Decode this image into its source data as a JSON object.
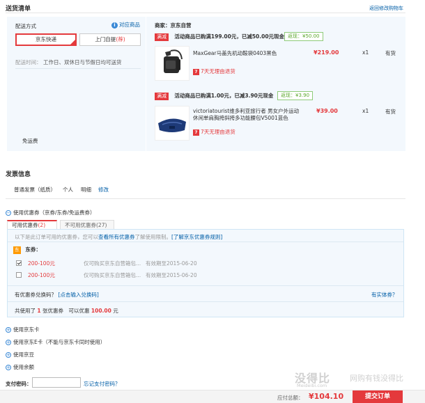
{
  "header": {
    "title": "送货清单",
    "back_link": "返回修改购物车"
  },
  "shipping": {
    "label": "配送方式",
    "help_link": "对应商品",
    "option_jd": "京东快递",
    "option_pickup": "上门自提",
    "pickup_badge": "荐",
    "time_label": "配送时间：",
    "time_value": "工作日、双休日与节假日均可送货",
    "free_shipping": "免运费"
  },
  "seller": {
    "label": "商家：京东自营"
  },
  "groups": [
    {
      "tag": "满减",
      "promo_text": "活动商品已购满199.00元，已减50.00元现金",
      "chip": "返现：¥50.00",
      "product": {
        "name": "MaxGear马盖先机动鞍袋0403黑色",
        "price": "¥219.00",
        "qty": "x1",
        "stock": "有货",
        "return_note": "7天无理由退货"
      }
    },
    {
      "tag": "满减",
      "promo_text": "活动商品已购满1.00元，已减3.90元现金",
      "chip": "返现：¥3.90",
      "product": {
        "name_line1": "victoriatourist维多利亚旅行者 男女户外运动",
        "name_line2": "休闲单肩胸挎斜挎多功能腰包V5001蓝色",
        "price": "¥39.00",
        "qty": "x1",
        "stock": "有货",
        "return_note": "7天无理由退货"
      }
    }
  ],
  "invoice": {
    "title": "发票信息",
    "type": "普通发票（纸质）",
    "person": "个人",
    "detail": "明细",
    "edit": "修改"
  },
  "coupons": {
    "toggle": "使用优惠券（京券/东券/免运费券）",
    "tab_available": "可用优惠券",
    "tab_available_count": "(2)",
    "tab_unavailable": "不可用优惠券",
    "tab_unavailable_count": "(27)",
    "intro_prefix": "以下是此订单可用的优惠券，您可以",
    "intro_link": "查看所有优惠券",
    "intro_mid": "了解使用限制。",
    "intro_link2": "[了解京东优惠券规则]",
    "dong_badge": "东",
    "dong_label": "东券：",
    "items": [
      {
        "amount": "200-100元",
        "desc": "仅可购买京东自营箱包...",
        "valid": "有效期至2015-06-20",
        "checked": true
      },
      {
        "amount": "200-100元",
        "desc": "仅可购买京东自营箱包...",
        "valid": "有效期至2015-06-20",
        "checked": false
      }
    ],
    "code_label": "有优惠券兑换码？",
    "code_link": "[点击输入兑换码]",
    "physical_link": "有实体券？",
    "summary_prefix": "共使用了",
    "summary_count": "1",
    "summary_mid": "张优惠券　可以优惠",
    "summary_amount": "100.00",
    "summary_suffix": "元"
  },
  "extras": {
    "jd_card": "使用京东卡",
    "jd_ecard": "使用京东E卡（不能与京东卡同时使用）",
    "jd_beans": "使用京豆",
    "balance": "使用余额"
  },
  "payment": {
    "pwd_label": "支付密码：",
    "forgot": "忘记支付密码？"
  },
  "footer": {
    "total_label": "应付总额：",
    "total_value": "¥104.10",
    "submit": "提交订单"
  },
  "watermark": {
    "main": "没得比",
    "sub": "网购有钱没得比",
    "url": "Meideibi.com"
  },
  "colors": {
    "accent": "#e4393c",
    "link": "#005ea7",
    "panel_bg": "#f3f8fd",
    "chip_green": "#5aa72b"
  }
}
